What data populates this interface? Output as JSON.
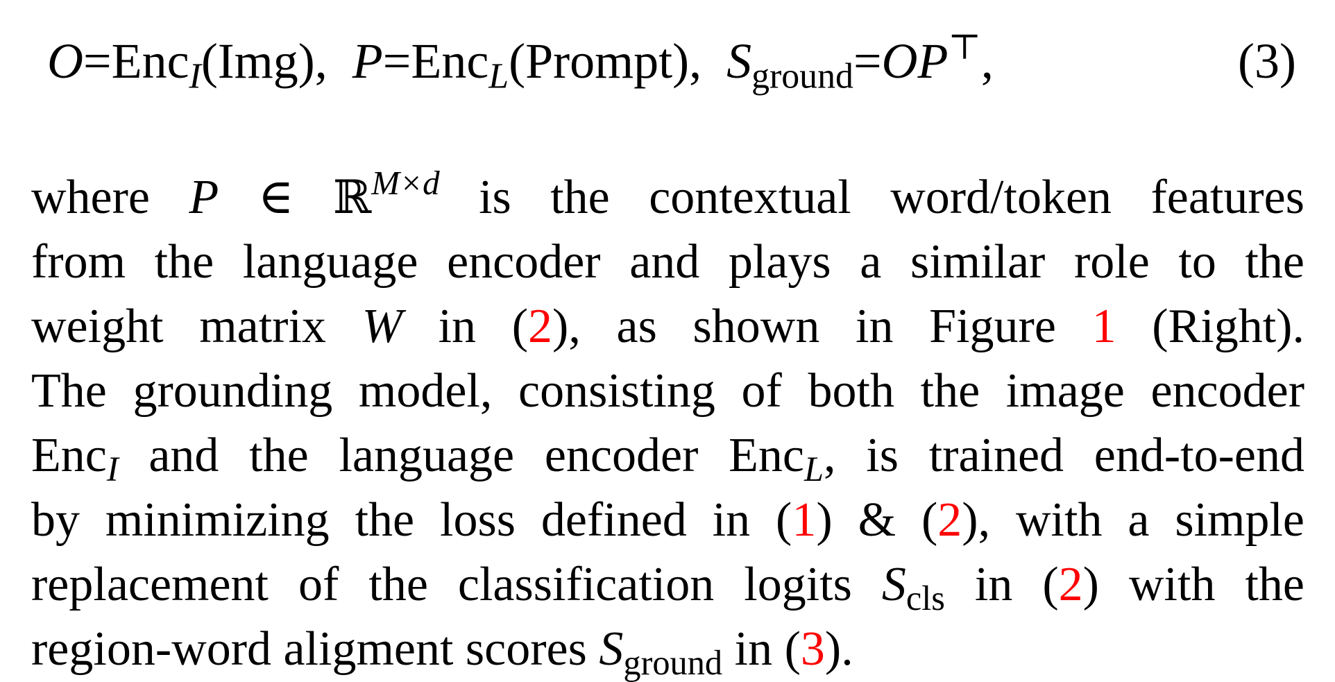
{
  "equation": {
    "O": "O",
    "eq1": "=",
    "enc": "Enc",
    "sub_I": "I",
    "img_arg": "(Img),",
    "P": "P",
    "eq2": "=",
    "sub_L": "L",
    "prompt_arg": "(Prompt),",
    "S": "S",
    "sub_ground": "ground",
    "eq3": "=",
    "OP": "OP",
    "transpose": "⊤",
    "comma": ",",
    "number": "(3)"
  },
  "paragraph": {
    "l1_a": "where ",
    "l1_P": "P",
    "l1_in": " ∈ ",
    "l1_R": "ℝ",
    "l1_sup": "M×d",
    "l1_b": " is the contextual word/token features",
    "l2": "from the language encoder and plays a similar role to the",
    "l3_a": "weight matrix ",
    "l3_W": "W",
    "l3_b": " in (",
    "l3_ref2": "2",
    "l3_c": "), as shown in Figure ",
    "l3_ref1": "1",
    "l3_d": " (Right).",
    "l4": "The grounding model, consisting of both the image encoder",
    "l5_enc1": "Enc",
    "l5_sub1": "I",
    "l5_a": " and the language encoder ",
    "l5_enc2": "Enc",
    "l5_sub2": "L",
    "l5_b": ", is trained end-to-end",
    "l6_a": "by minimizing the loss defined in (",
    "l6_ref1": "1",
    "l6_b": ") & (",
    "l6_ref2": "2",
    "l6_c": "), with a simple",
    "l7_a": "replacement of the classification logits ",
    "l7_S": "S",
    "l7_sub": "cls",
    "l7_b": " in (",
    "l7_ref2": "2",
    "l7_c": ") with the",
    "l8_a": "region-word aligment scores ",
    "l8_S": "S",
    "l8_sub": "ground",
    "l8_b": " in (",
    "l8_ref3": "3",
    "l8_c": ")."
  }
}
